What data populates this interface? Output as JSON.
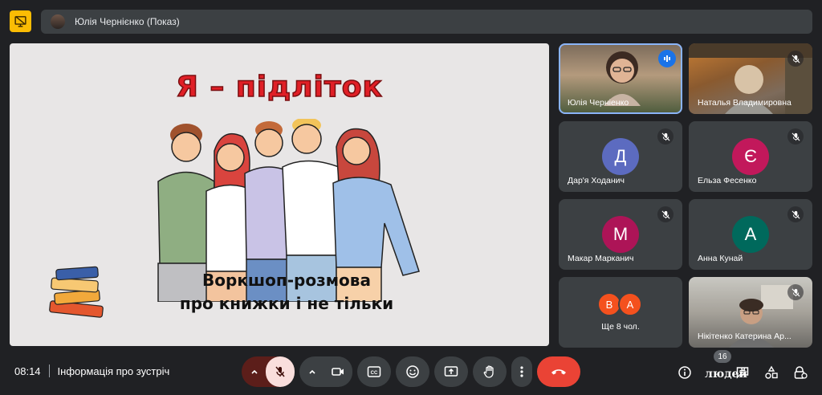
{
  "header": {
    "presenter_label": "Юлія Чернієнко (Показ)"
  },
  "slide": {
    "title": "Я – підліток",
    "subtitle_line1": "Воркшоп-розмова",
    "subtitle_line2": "про книжки і не тільки"
  },
  "participants": [
    {
      "name": "Юлія Черніенко",
      "type": "video",
      "speaking": true
    },
    {
      "name": "Наталья Владимировна",
      "type": "video",
      "muted": true
    },
    {
      "name": "Дар'я Ходанич",
      "initial": "Д",
      "color": "#5c6bc0",
      "muted": true
    },
    {
      "name": "Ельза Фесенко",
      "initial": "Є",
      "color": "#c2185b",
      "muted": true
    },
    {
      "name": "Макар Марканич",
      "initial": "М",
      "color": "#ad1457",
      "muted": true
    },
    {
      "name": "Анна Кунай",
      "initial": "А",
      "color": "#00695c",
      "muted": true
    },
    {
      "name": "Нікітенко Катерина Ар...",
      "type": "video",
      "muted": true
    }
  ],
  "others": {
    "avatars": [
      {
        "initial": "В",
        "color": "#f4511e"
      },
      {
        "initial": "А",
        "color": "#f4511e"
      }
    ],
    "label": "Ще 8 чол."
  },
  "footer": {
    "time": "08:14",
    "meeting_info": "Інформація про зустріч",
    "people_count": "16",
    "people_label": "людей"
  },
  "colors": {
    "background": "#202124",
    "tile": "#3c4043",
    "end_call": "#ea4335",
    "mic_off_bg": "#f9dedc",
    "active_outline": "#8ab4f8"
  }
}
